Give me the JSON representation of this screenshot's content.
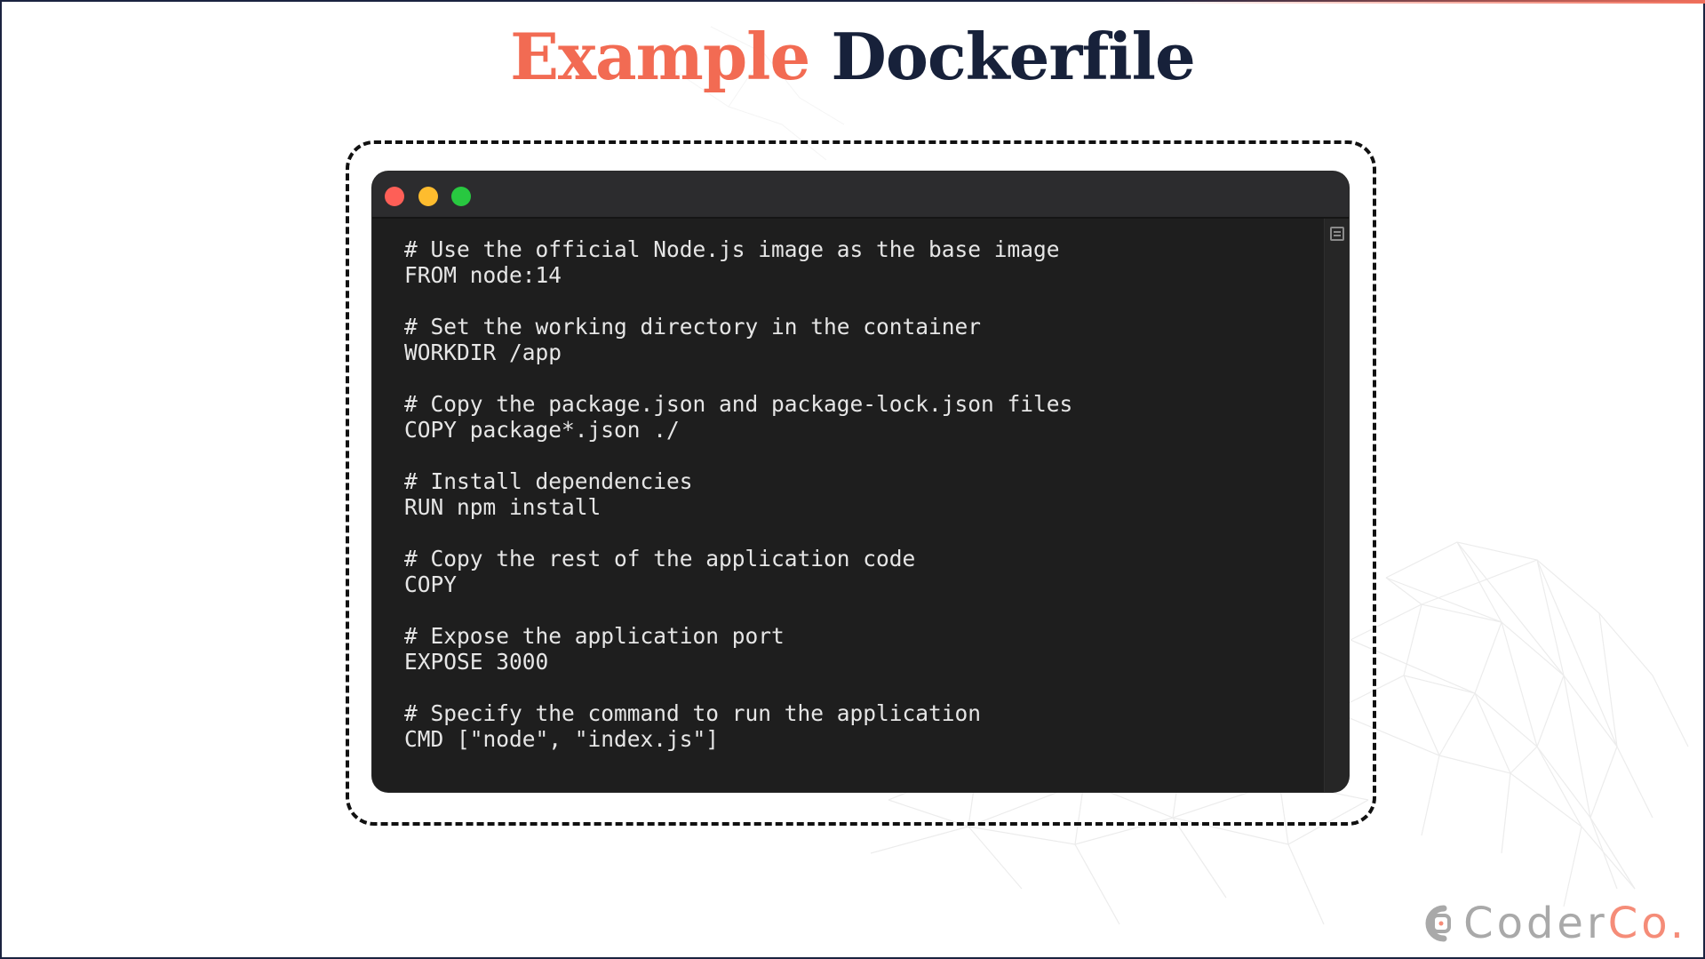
{
  "slide": {
    "title_accent": "Example",
    "title_main": "Dockerfile"
  },
  "terminal": {
    "lines": [
      "# Use the official Node.js image as the base image",
      "FROM node:14",
      "",
      "# Set the working directory in the container",
      "WORKDIR /app",
      "",
      "# Copy the package.json and package-lock.json files",
      "COPY package*.json ./",
      "",
      "# Install dependencies",
      "RUN npm install",
      "",
      "# Copy the rest of the application code",
      "COPY",
      "",
      "# Expose the application port",
      "EXPOSE 3000",
      "",
      "# Specify the command to run the application",
      "CMD [\"node\", \"index.js\"]"
    ],
    "controls": [
      "close",
      "minimize",
      "maximize"
    ],
    "scroll_icon": "split-pane-icon"
  },
  "logo": {
    "text_main": "Coder",
    "text_accent": "Co.",
    "icon": "coderco-logo-icon"
  },
  "colors": {
    "accent": "#f26b53",
    "title_dark": "#17213a",
    "terminal_bg": "#1e1e1e",
    "code_text": "#e6e6e6",
    "close": "#fe5f57",
    "minimize": "#febc2e",
    "maximize": "#28c840"
  }
}
